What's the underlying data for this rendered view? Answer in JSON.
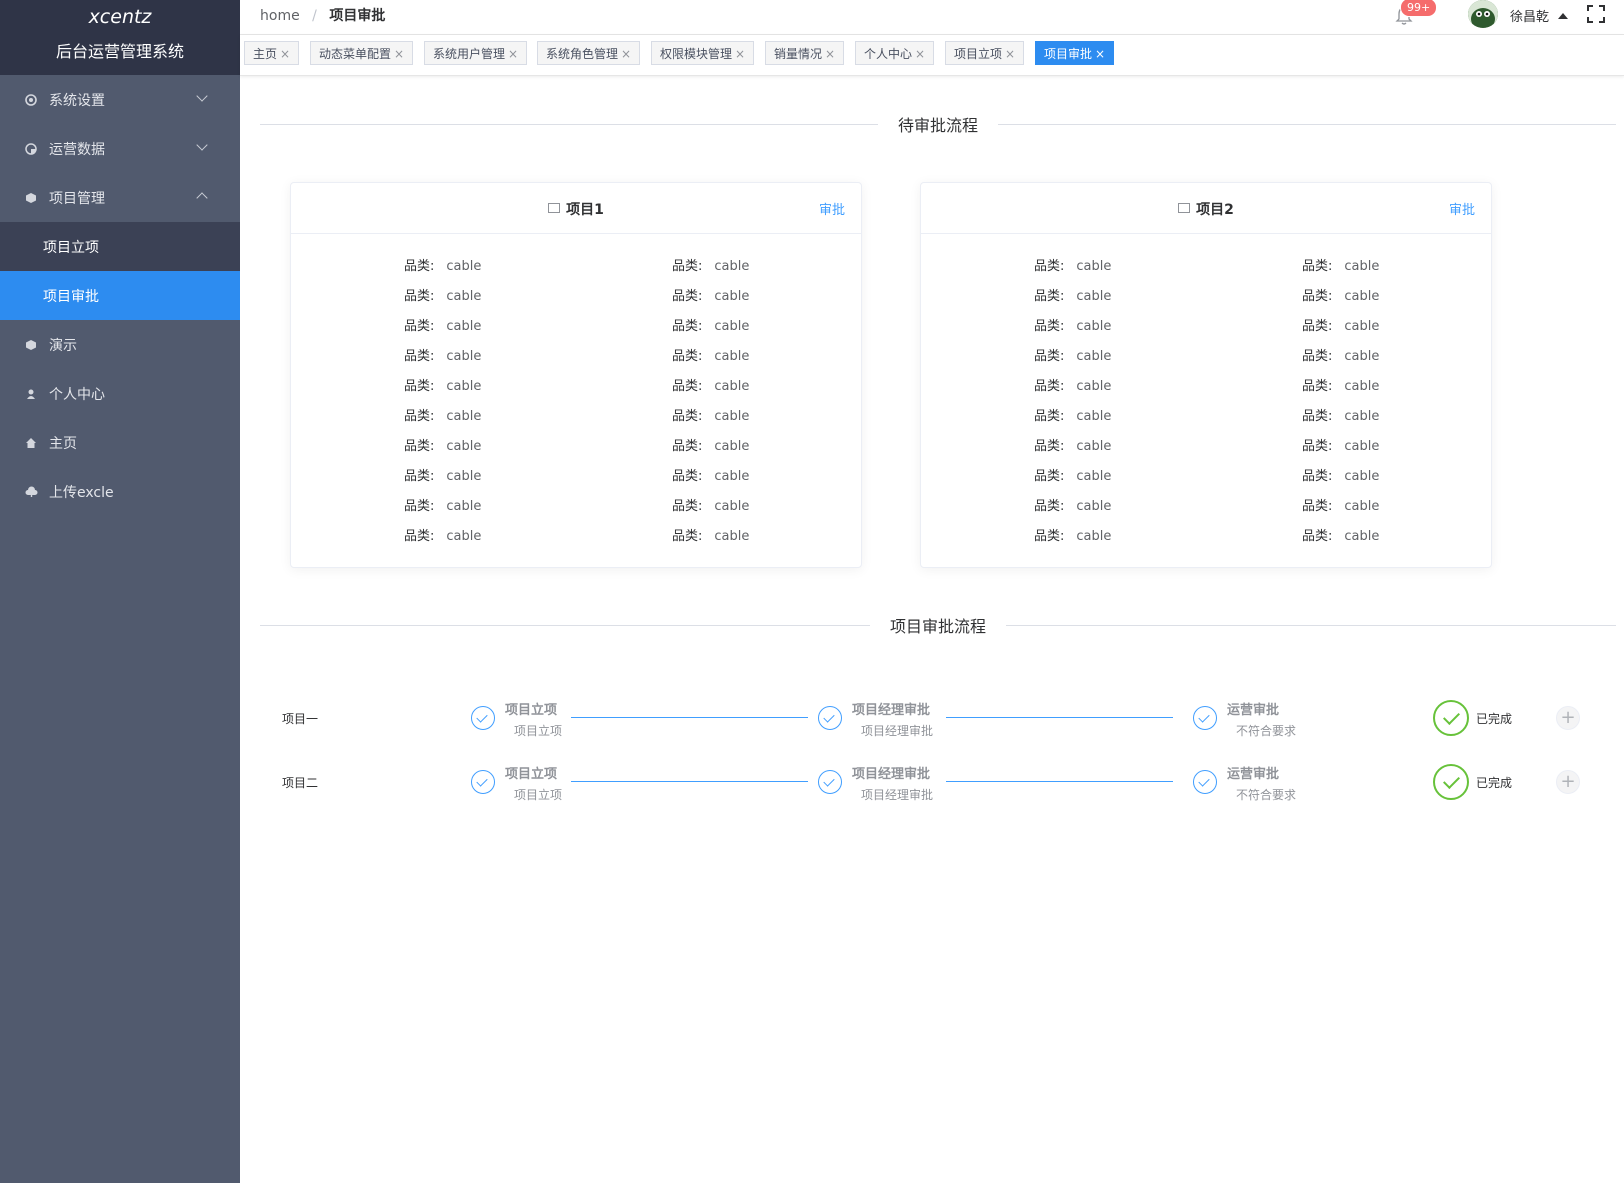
{
  "sidebar": {
    "brand": "xcentz",
    "system_name": "后台运营管理系统",
    "items": [
      {
        "label": "系统设置",
        "icon": "settings-icon"
      },
      {
        "label": "运营数据",
        "icon": "chart-icon"
      },
      {
        "label": "项目管理",
        "icon": "cube-icon"
      },
      {
        "label": "演示",
        "icon": "cube-icon"
      },
      {
        "label": "个人中心",
        "icon": "user-icon"
      },
      {
        "label": "主页",
        "icon": "home-icon"
      },
      {
        "label": "上传excle",
        "icon": "cloud-upload-icon"
      }
    ],
    "sub_items": [
      {
        "label": "项目立项"
      },
      {
        "label": "项目审批"
      }
    ]
  },
  "header": {
    "breadcrumb_home": "home",
    "breadcrumb_sep": "/",
    "breadcrumb_current": "项目审批",
    "notify_badge": "99+",
    "username": "徐昌乾"
  },
  "tabs": [
    {
      "label": "主页",
      "close": "×"
    },
    {
      "label": "动态菜单配置",
      "close": "×"
    },
    {
      "label": "系统用户管理",
      "close": "×"
    },
    {
      "label": "系统角色管理",
      "close": "×"
    },
    {
      "label": "权限模块管理",
      "close": "×"
    },
    {
      "label": "销量情况",
      "close": "×"
    },
    {
      "label": "个人中心",
      "close": "×"
    },
    {
      "label": "项目立项",
      "close": "×"
    },
    {
      "label": "项目审批",
      "close": "×"
    }
  ],
  "pending": {
    "title": "待审批流程",
    "cards": [
      {
        "title": "项目1",
        "action": "审批",
        "key": "品类:",
        "value": "cable"
      },
      {
        "title": "项目2",
        "action": "审批",
        "key": "品类:",
        "value": "cable"
      }
    ]
  },
  "flow": {
    "title": "项目审批流程",
    "rows": [
      {
        "name": "项目一",
        "steps": [
          {
            "title": "项目立项",
            "desc": "项目立项"
          },
          {
            "title": "项目经理审批",
            "desc": "项目经理审批"
          },
          {
            "title": "运营审批",
            "desc": "不符合要求"
          }
        ],
        "done": "已完成",
        "plus": "+"
      },
      {
        "name": "项目二",
        "steps": [
          {
            "title": "项目立项",
            "desc": "项目立项"
          },
          {
            "title": "项目经理审批",
            "desc": "项目经理审批"
          },
          {
            "title": "运营审批",
            "desc": "不符合要求"
          }
        ],
        "done": "已完成",
        "plus": "+"
      }
    ]
  },
  "colors": {
    "sidebar_bg": "#515a6e",
    "logo_bg": "#2f3447",
    "active": "#2d8cf0",
    "link": "#409eff",
    "success": "#67c23a",
    "badge": "#f56c6c"
  }
}
